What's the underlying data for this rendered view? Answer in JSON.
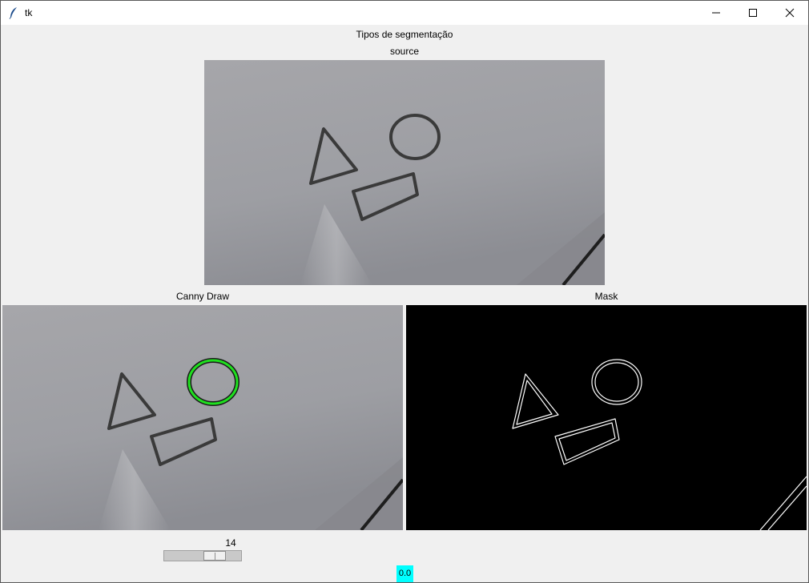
{
  "window": {
    "title": "tk",
    "icon": "feather-icon",
    "controls": [
      "minimize-icon",
      "maximize-icon",
      "close-icon"
    ]
  },
  "labels": {
    "main_title": "Tipos de segmentação",
    "source": "source",
    "canny": "Canny Draw",
    "mask": "Mask"
  },
  "slider": {
    "value": "14",
    "level_fraction": 0.72
  },
  "status": {
    "value": "0.0",
    "color": "#00ffff"
  },
  "colors": {
    "highlight_contour": "#1fe01f",
    "mask_background": "#000000",
    "mask_edges": "#ffffff"
  }
}
